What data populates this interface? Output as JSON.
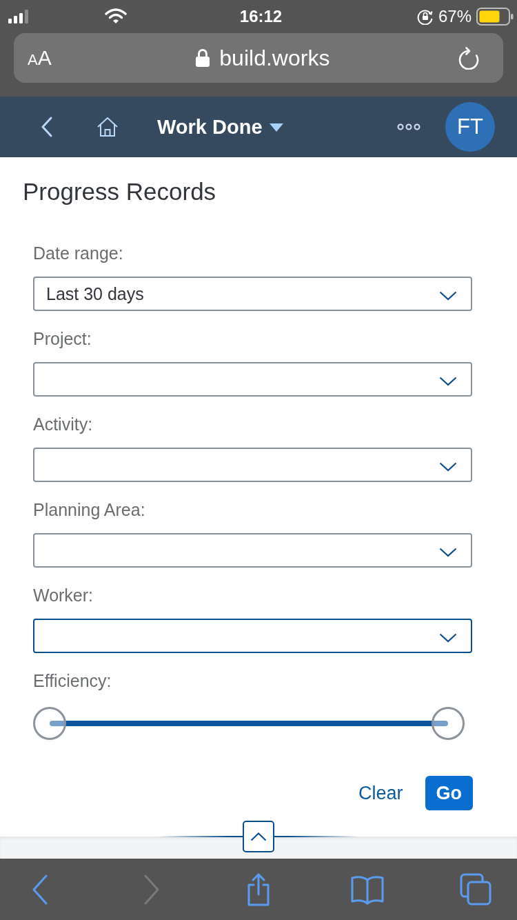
{
  "status_bar": {
    "time": "16:12",
    "battery": "67%"
  },
  "browser": {
    "text_size": "AA",
    "url": "build.works"
  },
  "app_bar": {
    "title": "Work Done",
    "avatar": "FT"
  },
  "page": {
    "title": "Progress Records"
  },
  "filters": [
    {
      "label": "Date range:",
      "value": "Last 30 days",
      "focused": false
    },
    {
      "label": "Project:",
      "focused": false
    },
    {
      "label": "Activity:",
      "focused": false
    },
    {
      "label": "Planning Area:",
      "focused": false
    },
    {
      "label": "Worker:",
      "focused": true
    }
  ],
  "efficiency": {
    "label": "Efficiency:",
    "thumbs": [
      {
        "level": 0
      },
      {
        "level": 1
      }
    ]
  },
  "actions": [
    {
      "label": "Clear",
      "kind": "text"
    },
    {
      "label": "Go",
      "kind": "primary"
    }
  ],
  "toolbar": {
    "items": [
      {
        "kind": "back",
        "disabled": false
      },
      {
        "kind": "forward",
        "disabled": true
      },
      {
        "kind": "share",
        "disabled": false
      },
      {
        "kind": "bookmarks",
        "disabled": false
      },
      {
        "kind": "tabs",
        "disabled": false
      }
    ]
  }
}
